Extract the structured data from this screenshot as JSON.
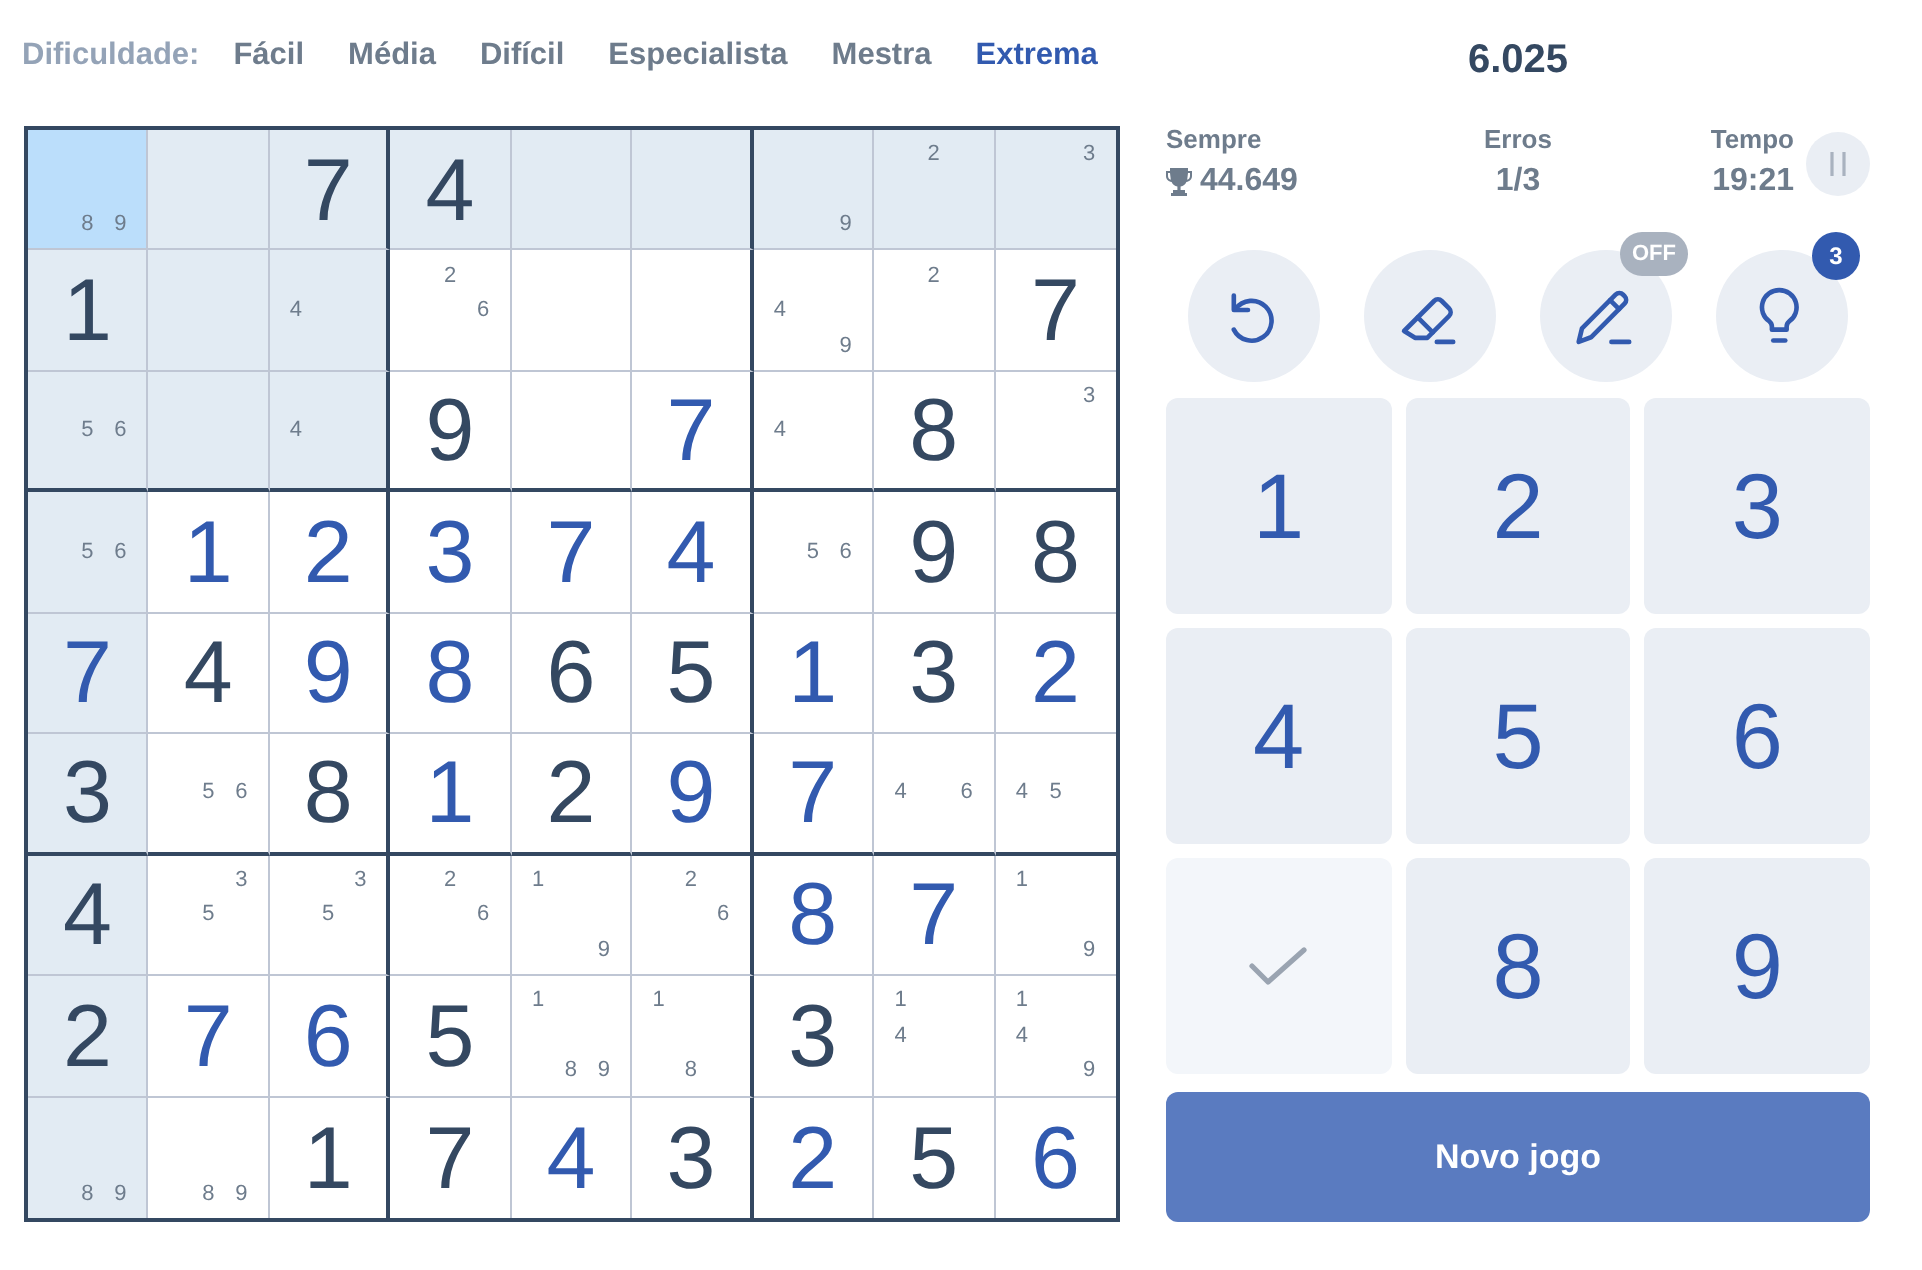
{
  "difficulty": {
    "label": "Dificuldade:",
    "options": [
      {
        "label": "Fácil",
        "selected": false
      },
      {
        "label": "Média",
        "selected": false
      },
      {
        "label": "Difícil",
        "selected": false
      },
      {
        "label": "Especialista",
        "selected": false
      },
      {
        "label": "Mestra",
        "selected": false
      },
      {
        "label": "Extrema",
        "selected": true
      }
    ]
  },
  "board": {
    "rows": [
      {
        "cells": [
          {
            "notes": [
              "8",
              "9"
            ],
            "selected": true
          },
          {
            "selected": false
          },
          {
            "value": "7",
            "kind": "given",
            "selected": false
          },
          {
            "value": "4",
            "kind": "given",
            "selected": false
          },
          {
            "selected": false
          },
          {
            "selected": false
          },
          {
            "notes": [
              "9"
            ],
            "selected": false
          },
          {
            "notes": [
              "2"
            ],
            "selected": false
          },
          {
            "notes": [
              "3"
            ],
            "selected": false
          }
        ]
      },
      {
        "cells": [
          {
            "value": "1",
            "kind": "given",
            "selected": false
          },
          {
            "selected": false
          },
          {
            "notes": [
              "4"
            ],
            "selected": false
          },
          {
            "notes": [
              "2",
              "6"
            ],
            "selected": false
          },
          {
            "selected": false
          },
          {
            "selected": false
          },
          {
            "notes": [
              "4",
              "9"
            ],
            "selected": false
          },
          {
            "notes": [
              "2"
            ],
            "selected": false
          },
          {
            "value": "7",
            "kind": "given",
            "selected": false
          }
        ]
      },
      {
        "cells": [
          {
            "notes": [
              "5",
              "6"
            ],
            "selected": false
          },
          {
            "selected": false
          },
          {
            "notes": [
              "4"
            ],
            "selected": false
          },
          {
            "value": "9",
            "kind": "given",
            "selected": false
          },
          {
            "selected": false
          },
          {
            "value": "7",
            "kind": "entered",
            "selected": false
          },
          {
            "notes": [
              "4"
            ],
            "selected": false
          },
          {
            "value": "8",
            "kind": "given",
            "selected": false
          },
          {
            "notes": [
              "3"
            ],
            "selected": false
          }
        ]
      },
      {
        "cells": [
          {
            "notes": [
              "5",
              "6"
            ],
            "selected": false
          },
          {
            "value": "1",
            "kind": "entered",
            "selected": false
          },
          {
            "value": "2",
            "kind": "entered",
            "selected": false
          },
          {
            "value": "3",
            "kind": "entered",
            "selected": false
          },
          {
            "value": "7",
            "kind": "entered",
            "selected": false
          },
          {
            "value": "4",
            "kind": "entered",
            "selected": false
          },
          {
            "notes": [
              "5",
              "6"
            ],
            "selected": false
          },
          {
            "value": "9",
            "kind": "given",
            "selected": false
          },
          {
            "value": "8",
            "kind": "given",
            "selected": false
          }
        ]
      },
      {
        "cells": [
          {
            "value": "7",
            "kind": "entered",
            "selected": false
          },
          {
            "value": "4",
            "kind": "given",
            "selected": false
          },
          {
            "value": "9",
            "kind": "entered",
            "selected": false
          },
          {
            "value": "8",
            "kind": "entered",
            "selected": false
          },
          {
            "value": "6",
            "kind": "given",
            "selected": false
          },
          {
            "value": "5",
            "kind": "given",
            "selected": false
          },
          {
            "value": "1",
            "kind": "entered",
            "selected": false
          },
          {
            "value": "3",
            "kind": "given",
            "selected": false
          },
          {
            "value": "2",
            "kind": "entered",
            "selected": false
          }
        ]
      },
      {
        "cells": [
          {
            "value": "3",
            "kind": "given",
            "selected": false
          },
          {
            "notes": [
              "5",
              "6"
            ],
            "selected": false
          },
          {
            "value": "8",
            "kind": "given",
            "selected": false
          },
          {
            "value": "1",
            "kind": "entered",
            "selected": false
          },
          {
            "value": "2",
            "kind": "given",
            "selected": false
          },
          {
            "value": "9",
            "kind": "entered",
            "selected": false
          },
          {
            "value": "7",
            "kind": "entered",
            "selected": false
          },
          {
            "notes": [
              "4",
              "6"
            ],
            "selected": false
          },
          {
            "notes": [
              "4",
              "5"
            ],
            "selected": false
          }
        ]
      },
      {
        "cells": [
          {
            "value": "4",
            "kind": "given",
            "selected": false
          },
          {
            "notes": [
              "3",
              "5"
            ],
            "selected": false
          },
          {
            "notes": [
              "3",
              "5"
            ],
            "selected": false
          },
          {
            "notes": [
              "2",
              "6"
            ],
            "selected": false
          },
          {
            "notes": [
              "1",
              "9"
            ],
            "selected": false
          },
          {
            "notes": [
              "2",
              "6"
            ],
            "selected": false
          },
          {
            "value": "8",
            "kind": "entered",
            "selected": false
          },
          {
            "value": "7",
            "kind": "entered",
            "selected": false
          },
          {
            "notes": [
              "1",
              "9"
            ],
            "selected": false
          }
        ]
      },
      {
        "cells": [
          {
            "value": "2",
            "kind": "given",
            "selected": false
          },
          {
            "value": "7",
            "kind": "entered",
            "selected": false
          },
          {
            "value": "6",
            "kind": "entered",
            "selected": false
          },
          {
            "value": "5",
            "kind": "given",
            "selected": false
          },
          {
            "notes": [
              "1",
              "8",
              "9"
            ],
            "selected": false
          },
          {
            "notes": [
              "1",
              "8"
            ],
            "selected": false
          },
          {
            "value": "3",
            "kind": "given",
            "selected": false
          },
          {
            "notes": [
              "1",
              "4"
            ],
            "selected": false
          },
          {
            "notes": [
              "1",
              "4",
              "9"
            ],
            "selected": false
          }
        ]
      },
      {
        "cells": [
          {
            "notes": [
              "8",
              "9"
            ],
            "selected": false
          },
          {
            "notes": [
              "8",
              "9"
            ],
            "selected": false
          },
          {
            "value": "1",
            "kind": "given",
            "selected": false
          },
          {
            "value": "7",
            "kind": "given",
            "selected": false
          },
          {
            "value": "4",
            "kind": "entered",
            "selected": false
          },
          {
            "value": "3",
            "kind": "given",
            "selected": false
          },
          {
            "value": "2",
            "kind": "entered",
            "selected": false
          },
          {
            "value": "5",
            "kind": "given",
            "selected": false
          },
          {
            "value": "6",
            "kind": "entered",
            "selected": false
          }
        ]
      }
    ]
  },
  "score": "6.025",
  "stats": [
    {
      "kind": "best",
      "label": "Sempre",
      "value": "44.649"
    },
    {
      "kind": "plain",
      "label": "Erros",
      "value": "1/3"
    },
    {
      "kind": "time",
      "label": "Tempo",
      "value": "19:21"
    }
  ],
  "tools": [
    {
      "kind": "undo"
    },
    {
      "kind": "erase"
    },
    {
      "kind": "notes",
      "badge": "OFF"
    },
    {
      "kind": "hint",
      "badge": "3"
    }
  ],
  "numpad": [
    {
      "kind": "digit",
      "label": "1"
    },
    {
      "kind": "digit",
      "label": "2"
    },
    {
      "kind": "digit",
      "label": "3"
    },
    {
      "kind": "digit",
      "label": "4"
    },
    {
      "kind": "digit",
      "label": "5"
    },
    {
      "kind": "digit",
      "label": "6"
    },
    {
      "kind": "done"
    },
    {
      "kind": "digit",
      "label": "8"
    },
    {
      "kind": "digit",
      "label": "9"
    }
  ],
  "new_game_button": "Novo jogo"
}
